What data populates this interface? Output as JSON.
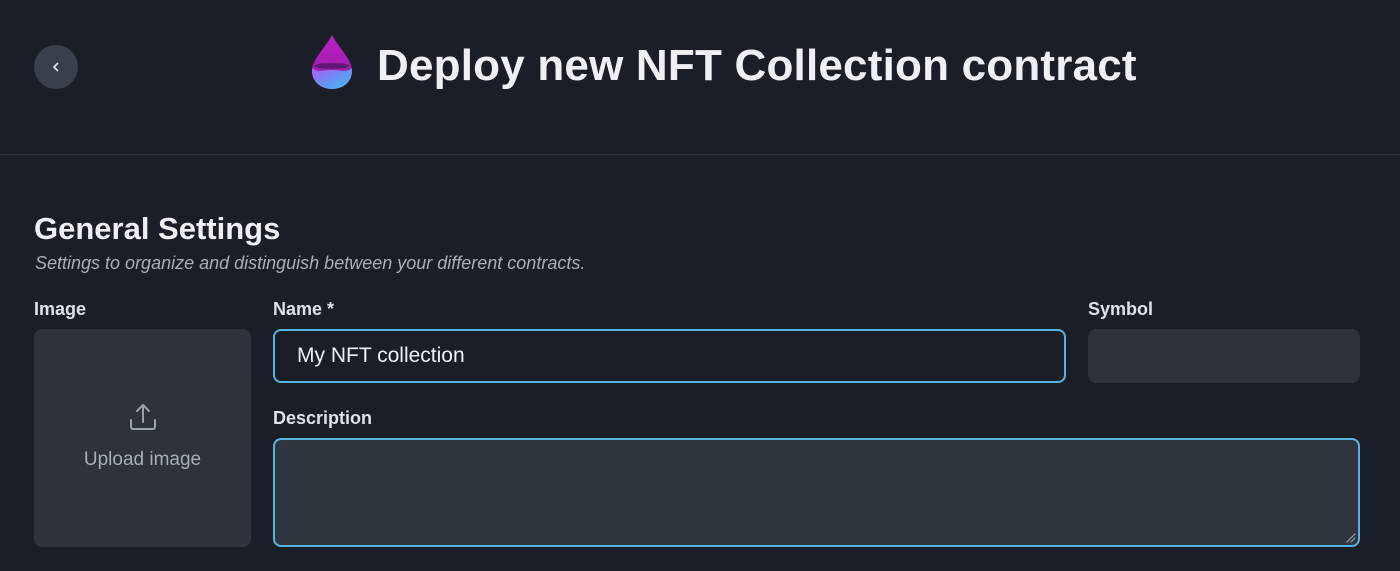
{
  "header": {
    "title": "Deploy new NFT Collection contract",
    "back_icon": "chevron-left-icon",
    "logo_icon": "nft-drop-logo-icon"
  },
  "section": {
    "title": "General Settings",
    "subtitle": "Settings to organize and distinguish between your different contracts."
  },
  "fields": {
    "image": {
      "label": "Image",
      "upload_text": "Upload image",
      "icon": "upload-icon"
    },
    "name": {
      "label": "Name *",
      "value": "My NFT collection"
    },
    "symbol": {
      "label": "Symbol",
      "value": ""
    },
    "description": {
      "label": "Description",
      "value": ""
    }
  },
  "colors": {
    "background": "#1a1e26",
    "input_fill": "#2d323b",
    "focus_border": "#58b3e0",
    "logo_top": "#a81fb8",
    "logo_bottom": "#4fb6f0"
  }
}
